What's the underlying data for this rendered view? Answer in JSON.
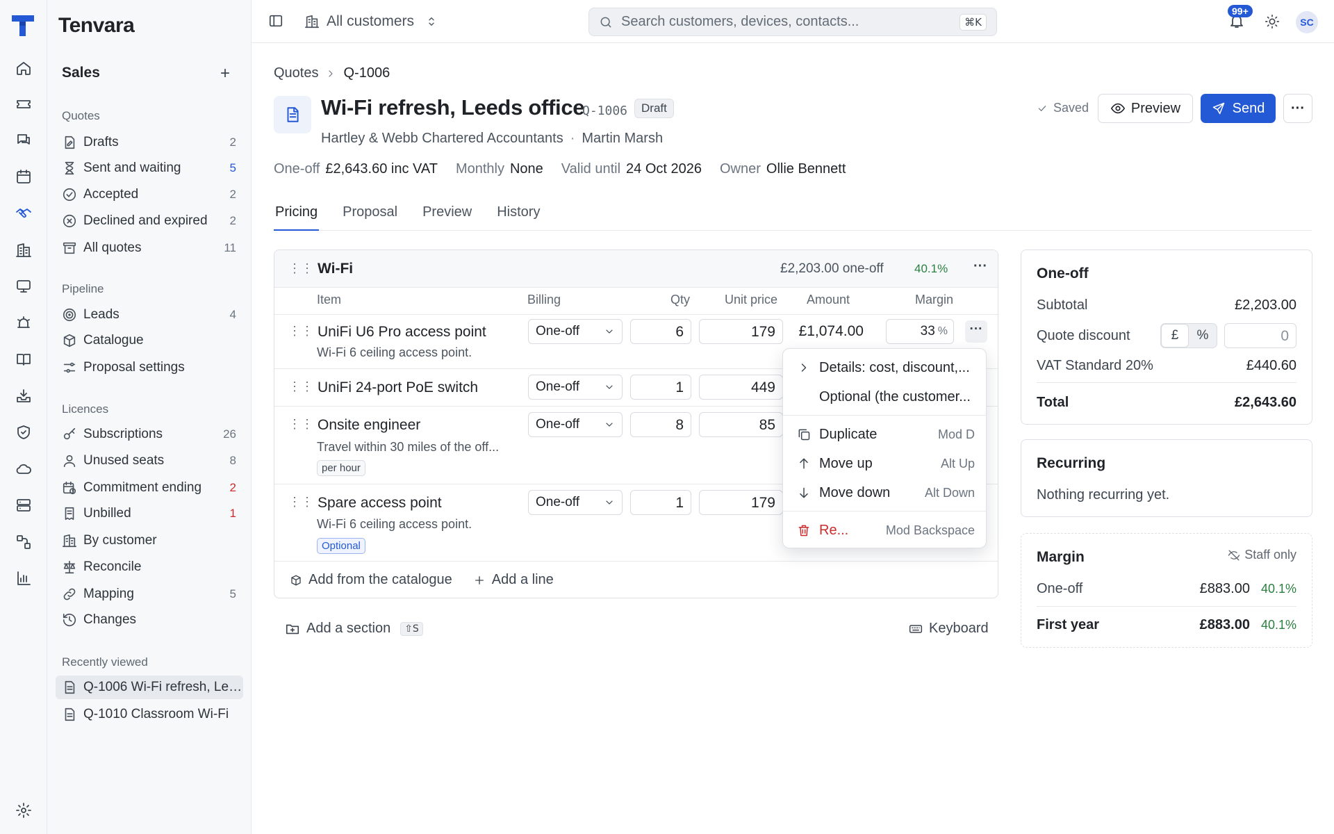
{
  "app": {
    "name": "Tenvara"
  },
  "rail": {
    "icons": [
      "home-icon",
      "ticket-icon",
      "chat-icon",
      "calendar-icon",
      "handshake-icon",
      "building-icon",
      "monitor-icon",
      "alarm-icon",
      "book-icon",
      "inbox-icon",
      "shield-icon",
      "cloud-icon",
      "server-icon",
      "workflow-icon",
      "chart-icon",
      "settings-icon"
    ],
    "active": "handshake-icon"
  },
  "sidebar": {
    "section_title": "Sales",
    "groups": {
      "quotes": {
        "label": "Quotes",
        "items": [
          {
            "label": "Drafts",
            "count": "2"
          },
          {
            "label": "Sent and waiting",
            "count": "5"
          },
          {
            "label": "Accepted",
            "count": "2"
          },
          {
            "label": "Declined and expired",
            "count": "2"
          },
          {
            "label": "All quotes",
            "count": "11"
          }
        ]
      },
      "pipeline": {
        "label": "Pipeline",
        "items": [
          {
            "label": "Leads",
            "count": "4"
          },
          {
            "label": "Catalogue"
          },
          {
            "label": "Proposal settings"
          }
        ]
      },
      "licences": {
        "label": "Licences",
        "items": [
          {
            "label": "Subscriptions",
            "count": "26"
          },
          {
            "label": "Unused seats",
            "count": "8"
          },
          {
            "label": "Commitment ending",
            "count": "2"
          },
          {
            "label": "Unbilled",
            "count": "1"
          },
          {
            "label": "By customer"
          },
          {
            "label": "Reconcile"
          },
          {
            "label": "Mapping",
            "count": "5"
          },
          {
            "label": "Changes"
          }
        ]
      },
      "recent": {
        "label": "Recently viewed",
        "items": [
          {
            "label": "Q-1006 Wi-Fi refresh, Leeds office"
          },
          {
            "label": "Q-1010 Classroom Wi-Fi"
          }
        ]
      }
    }
  },
  "topbar": {
    "customer_scope": "All customers",
    "search_placeholder": "Search customers, devices, contacts...",
    "search_shortcut": "⌘K",
    "notifications_badge": "99+",
    "avatar_initials": "SC"
  },
  "breadcrumb": {
    "parent": "Quotes",
    "current": "Q-1006"
  },
  "quote": {
    "title": "Wi-Fi refresh, Leeds office",
    "number": "Q-1006",
    "status": "Draft",
    "customer": "Hartley & Webb Chartered Accountants",
    "contact": "Martin Marsh",
    "saved_label": "Saved",
    "meta": {
      "oneoff_label": "One-off",
      "oneoff_value": "£2,643.60 inc VAT",
      "monthly_label": "Monthly",
      "monthly_value": "None",
      "valid_label": "Valid until",
      "valid_value": "24 Oct 2026",
      "owner_label": "Owner",
      "owner_value": "Ollie Bennett"
    }
  },
  "actions": {
    "preview": "Preview",
    "send": "Send",
    "more": "···"
  },
  "tabs": [
    "Pricing",
    "Proposal",
    "Preview",
    "History"
  ],
  "section": {
    "name": "Wi-Fi",
    "total": "£2,203.00 one-off",
    "margin": "40.1%",
    "columns": {
      "item": "Item",
      "billing": "Billing",
      "qty": "Qty",
      "unit_price": "Unit price",
      "amount": "Amount",
      "margin": "Margin"
    },
    "lines": [
      {
        "name": "UniFi U6 Pro access point",
        "desc": "Wi-Fi 6 ceiling access point.",
        "billing": "One-off",
        "qty": "6",
        "unit_price": "179",
        "amount": "£1,074.00",
        "margin": "33"
      },
      {
        "name": "UniFi 24-port PoE switch",
        "billing": "One-off",
        "qty": "1",
        "unit_price": "449"
      },
      {
        "name": "Onsite engineer",
        "desc": "Travel within 30 miles of the off...",
        "tag": "per hour",
        "billing": "One-off",
        "qty": "8",
        "unit_price": "85"
      },
      {
        "name": "Spare access point",
        "desc": "Wi-Fi 6 ceiling access point.",
        "tag": "Optional",
        "billing": "One-off",
        "qty": "1",
        "unit_price": "179"
      }
    ],
    "add_from_catalogue": "Add from the catalogue",
    "add_line": "Add a line"
  },
  "below": {
    "add_section": "Add a section",
    "add_section_kbd": "⇧S",
    "keyboard": "Keyboard"
  },
  "context_menu": {
    "details": "Details: cost, discount,...",
    "optional": "Optional (the customer...",
    "duplicate": "Duplicate",
    "duplicate_sc": "Mod D",
    "move_up": "Move up",
    "move_up_sc": "Alt Up",
    "move_down": "Move down",
    "move_down_sc": "Alt Down",
    "remove": "Re...",
    "remove_sc": "Mod Backspace"
  },
  "summary": {
    "oneoff": {
      "title": "One-off",
      "subtotal_label": "Subtotal",
      "subtotal": "£2,203.00",
      "discount_label": "Quote discount",
      "discount_mode_pounds": "£",
      "discount_mode_percent": "%",
      "discount_value": "0",
      "vat_label": "VAT Standard 20%",
      "vat": "£440.60",
      "total_label": "Total",
      "total": "£2,643.60"
    },
    "recurring": {
      "title": "Recurring",
      "empty": "Nothing recurring yet."
    },
    "margin": {
      "title": "Margin",
      "staff_only": "Staff only",
      "oneoff_label": "One-off",
      "oneoff_value": "£883.00",
      "oneoff_pct": "40.1%",
      "firstyear_label": "First year",
      "firstyear_value": "£883.00",
      "firstyear_pct": "40.1%"
    }
  },
  "colors": {
    "accent": "#2459d6",
    "positive": "#2a8040",
    "danger": "#cc2b2b"
  }
}
